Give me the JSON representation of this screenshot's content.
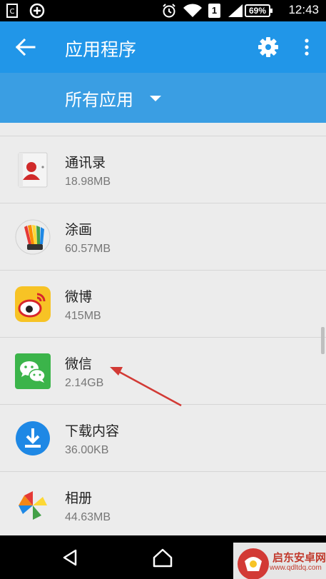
{
  "status_bar": {
    "time": "12:43",
    "battery": "69%",
    "sim": "1"
  },
  "app_bar": {
    "title": "应用程序"
  },
  "filter": {
    "label": "所有应用"
  },
  "apps": [
    {
      "name": "通讯录",
      "size": "18.98MB",
      "icon": "contacts-icon"
    },
    {
      "name": "涂画",
      "size": "60.57MB",
      "icon": "paint-icon"
    },
    {
      "name": "微博",
      "size": "415MB",
      "icon": "weibo-icon"
    },
    {
      "name": "微信",
      "size": "2.14GB",
      "icon": "wechat-icon"
    },
    {
      "name": "下载内容",
      "size": "36.00KB",
      "icon": "download-icon"
    },
    {
      "name": "相册",
      "size": "44.63MB",
      "icon": "photos-icon"
    }
  ],
  "watermark": {
    "title": "启东安卓网",
    "url": "www.qdltdq.com"
  },
  "colors": {
    "app_bar": "#2196e8",
    "filter_bar": "#3a9ee3",
    "annotation_arrow": "#d23a35"
  }
}
